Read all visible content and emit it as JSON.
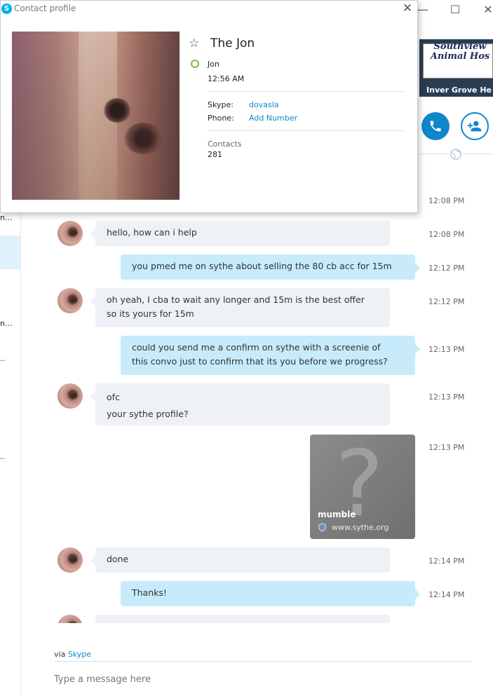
{
  "popup": {
    "title": "Contact profile",
    "name": "The Jon",
    "status_user": "Jon",
    "local_time": "12:56 AM",
    "skype_label": "Skype:",
    "skype_value": "dovasla",
    "phone_label": "Phone:",
    "phone_value": "Add Number",
    "contacts_label": "Contacts",
    "contacts_count": "281"
  },
  "sidebar": {
    "truncated": [
      "n...",
      "n...",
      "..",
      ".."
    ]
  },
  "ad": {
    "title": "Southview Animal Hos",
    "footer": "Inver Grove He"
  },
  "messages": [
    {
      "dir": "in",
      "lines": [
        "hello, how can i help"
      ],
      "time": "12:08 PM"
    },
    {
      "dir": "out",
      "lines": [
        "you pmed me on sythe about selling the 80 cb acc for 15m"
      ],
      "time": "12:12 PM"
    },
    {
      "dir": "in",
      "lines": [
        "oh yeah, I cba to wait any longer and 15m is the best offer so its yours for 15m"
      ],
      "time": "12:12 PM"
    },
    {
      "dir": "out",
      "lines": [
        "could you send me a confirm on sythe with a screenie of this convo just to confirm that its you before we progress?"
      ],
      "time": "12:13 PM"
    },
    {
      "dir": "in",
      "lines": [
        "ofc",
        "your sythe profile?"
      ],
      "time": "12:13 PM"
    },
    {
      "dir": "out",
      "card": true,
      "time": "12:13 PM"
    },
    {
      "dir": "in",
      "lines": [
        "done"
      ],
      "time": "12:14 PM"
    },
    {
      "dir": "out",
      "lines": [
        "Thanks!"
      ],
      "time": "12:14 PM"
    }
  ],
  "first_time": "12:08 PM",
  "link_card": {
    "title": "mumble",
    "url": "www.sythe.org"
  },
  "footer": {
    "via": "via",
    "via_link": "Skype",
    "placeholder": "Type a message here"
  },
  "colors": {
    "accent": "#0d87c9",
    "incoming_bubble": "#eef1f5",
    "outgoing_bubble": "#c7ebfa",
    "online": "#7cbf3a"
  }
}
